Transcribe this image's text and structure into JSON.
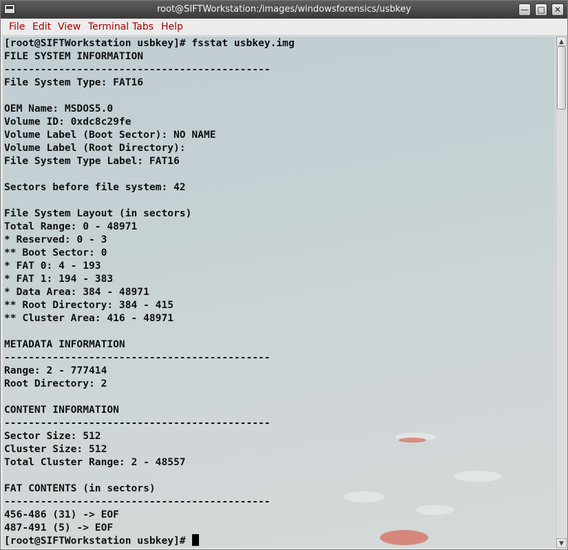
{
  "window": {
    "title": "root@SIFTWorkstation:/images/windowsforensics/usbkey",
    "minimize_glyph": "—",
    "maximize_glyph": "□",
    "close_glyph": "✕"
  },
  "menubar": {
    "items": [
      {
        "label": "File"
      },
      {
        "label": "Edit"
      },
      {
        "label": "View"
      },
      {
        "label": "Terminal"
      },
      {
        "label": "Tabs"
      },
      {
        "label": "Help"
      }
    ]
  },
  "terminal": {
    "lines": [
      "[root@SIFTWorkstation usbkey]# fsstat usbkey.img",
      "FILE SYSTEM INFORMATION",
      "--------------------------------------------",
      "File System Type: FAT16",
      "",
      "OEM Name: MSDOS5.0",
      "Volume ID: 0xdc8c29fe",
      "Volume Label (Boot Sector): NO NAME",
      "Volume Label (Root Directory):",
      "File System Type Label: FAT16",
      "",
      "Sectors before file system: 42",
      "",
      "File System Layout (in sectors)",
      "Total Range: 0 - 48971",
      "* Reserved: 0 - 3",
      "** Boot Sector: 0",
      "* FAT 0: 4 - 193",
      "* FAT 1: 194 - 383",
      "* Data Area: 384 - 48971",
      "** Root Directory: 384 - 415",
      "** Cluster Area: 416 - 48971",
      "",
      "METADATA INFORMATION",
      "--------------------------------------------",
      "Range: 2 - 777414",
      "Root Directory: 2",
      "",
      "CONTENT INFORMATION",
      "--------------------------------------------",
      "Sector Size: 512",
      "Cluster Size: 512",
      "Total Cluster Range: 2 - 48557",
      "",
      "FAT CONTENTS (in sectors)",
      "--------------------------------------------",
      "456-486 (31) -> EOF",
      "487-491 (5) -> EOF",
      "[root@SIFTWorkstation usbkey]# "
    ]
  },
  "scrollbar": {
    "up_glyph": "▲",
    "down_glyph": "▼",
    "position": 0.0
  },
  "colors": {
    "menu_text": "#a00000",
    "titlebar": "#4a4a4a",
    "terminal_bg": "#c6d1d4",
    "terminal_text": "#101010"
  }
}
